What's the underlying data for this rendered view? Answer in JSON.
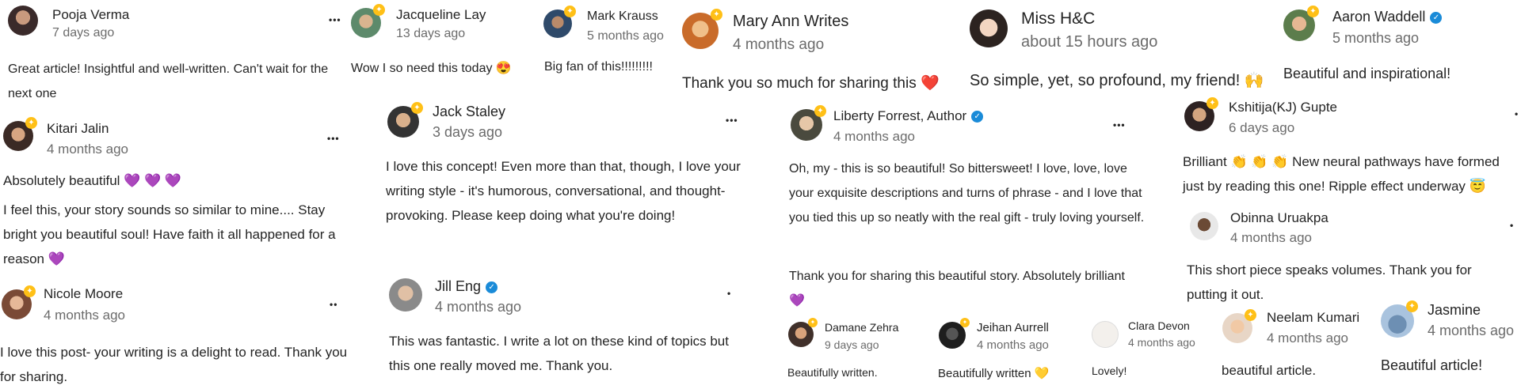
{
  "comments": {
    "pooja": {
      "name": "Pooja Verma",
      "time": "7 days ago",
      "text": "Great article! Insightful and well-written. Can't wait for the next one"
    },
    "jacqueline": {
      "name": "Jacqueline Lay",
      "time": "13 days ago",
      "text": "Wow I so need this today 😍"
    },
    "mark": {
      "name": "Mark Krauss",
      "time": "5 months ago",
      "text": "Big fan of this!!!!!!!!!"
    },
    "maryann": {
      "name": "Mary Ann Writes",
      "time": "4 months ago",
      "text": "Thank you so much for sharing this ❤️"
    },
    "misshc": {
      "name": "Miss H&C",
      "time": "about 15 hours ago",
      "text": "So simple, yet, so profound, my friend! 🙌"
    },
    "aaron": {
      "name": "Aaron Waddell",
      "time": "5 months ago",
      "text": "Beautiful and inspirational!"
    },
    "kitari": {
      "name": "Kitari Jalin",
      "time": "4 months ago",
      "line1": "Absolutely beautiful 💜 💜 💜",
      "text": "I feel this, your story sounds so similar to mine.... Stay bright you beautiful soul! Have faith it all happened for a reason 💜"
    },
    "jack": {
      "name": "Jack Staley",
      "time": "3 days ago",
      "text": "I love this concept! Even more than that, though, I love your writing style - it's humorous, conversational, and thought-provoking. Please keep doing what you're doing!"
    },
    "liberty": {
      "name": "Liberty Forrest, Author",
      "time": "4 months ago",
      "text": "Oh, my - this is so beautiful! So bittersweet! I love, love, love your exquisite descriptions and turns of phrase - and I love that you tied this up so neatly with the real gift - truly loving yourself.",
      "text2": "Thank you for sharing this beautiful story. Absolutely brilliant 💜"
    },
    "kshitija": {
      "name": "Kshitija(KJ) Gupte",
      "time": "6 days ago",
      "text": "Brilliant 👏 👏 👏 New neural pathways have formed just by reading this one! Ripple effect underway 😇"
    },
    "obinna": {
      "name": "Obinna Uruakpa",
      "time": "4 months ago",
      "text": "This short piece speaks volumes. Thank you for putting it out."
    },
    "nicole": {
      "name": "Nicole Moore",
      "time": "4 months ago",
      "text": "I love this post- your writing is a delight to read. Thank you for sharing."
    },
    "jill": {
      "name": "Jill Eng",
      "time": "4 months ago",
      "text": "This was fantastic. I write a lot on these kind of topics but this one really moved me. Thank you."
    },
    "damane": {
      "name": "Damane Zehra",
      "time": "9 days ago",
      "text": "Beautifully written."
    },
    "jeihan": {
      "name": "Jeihan Aurrell",
      "time": "4 months ago",
      "text": "Beautifully written 💛"
    },
    "clara": {
      "name": "Clara Devon",
      "time": "4 months ago",
      "text": "Lovely!"
    },
    "neelam": {
      "name": "Neelam Kumari",
      "time": "4 months ago",
      "text": "beautiful article."
    },
    "jasmine": {
      "name": "Jasmine",
      "time": "4 months ago",
      "text": "Beautiful article!"
    }
  },
  "ui": {
    "more_label": "•••",
    "more_label_2": "••",
    "more_label_1": "•",
    "star_icon": "✦",
    "verified_icon": "✓"
  }
}
